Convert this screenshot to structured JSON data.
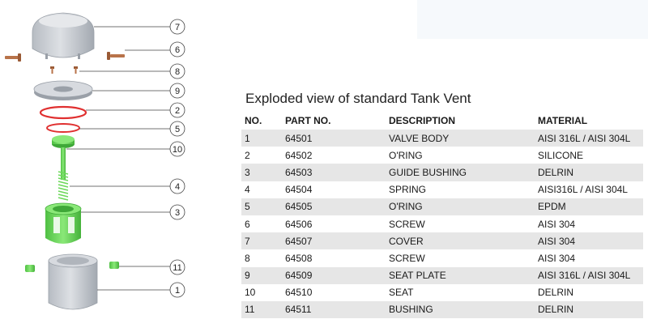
{
  "title": "Exploded view of standard Tank Vent",
  "table": {
    "headers": [
      "NO.",
      "PART NO.",
      "DESCRIPTION",
      "MATERIAL"
    ],
    "rows": [
      [
        "1",
        "64501",
        "VALVE BODY",
        "AISI 316L / AISI 304L"
      ],
      [
        "2",
        "64502",
        "O'RING",
        "SILICONE"
      ],
      [
        "3",
        "64503",
        "GUIDE BUSHING",
        "DELRIN"
      ],
      [
        "4",
        "64504",
        "SPRING",
        "AISI316L / AISI 304L"
      ],
      [
        "5",
        "64505",
        "O'RING",
        "EPDM"
      ],
      [
        "6",
        "64506",
        "SCREW",
        "AISI 304"
      ],
      [
        "7",
        "64507",
        "COVER",
        "AISI 304"
      ],
      [
        "8",
        "64508",
        "SCREW",
        "AISI 304"
      ],
      [
        "9",
        "64509",
        "SEAT PLATE",
        "AISI 316L / AISI 304L"
      ],
      [
        "10",
        "64510",
        "SEAT",
        "DELRIN"
      ],
      [
        "11",
        "64511",
        "BUSHING",
        "DELRIN"
      ]
    ]
  },
  "diagram": {
    "callouts": [
      "7",
      "6",
      "8",
      "9",
      "2",
      "5",
      "10",
      "4",
      "3",
      "11",
      "1"
    ],
    "colors": {
      "metal": "#c8ccd2",
      "metal_dark": "#9aa0a8",
      "screw": "#b8734a",
      "oring": "#e03030",
      "plastic_green": "#6cd85a",
      "green_dark": "#3fa838"
    }
  }
}
